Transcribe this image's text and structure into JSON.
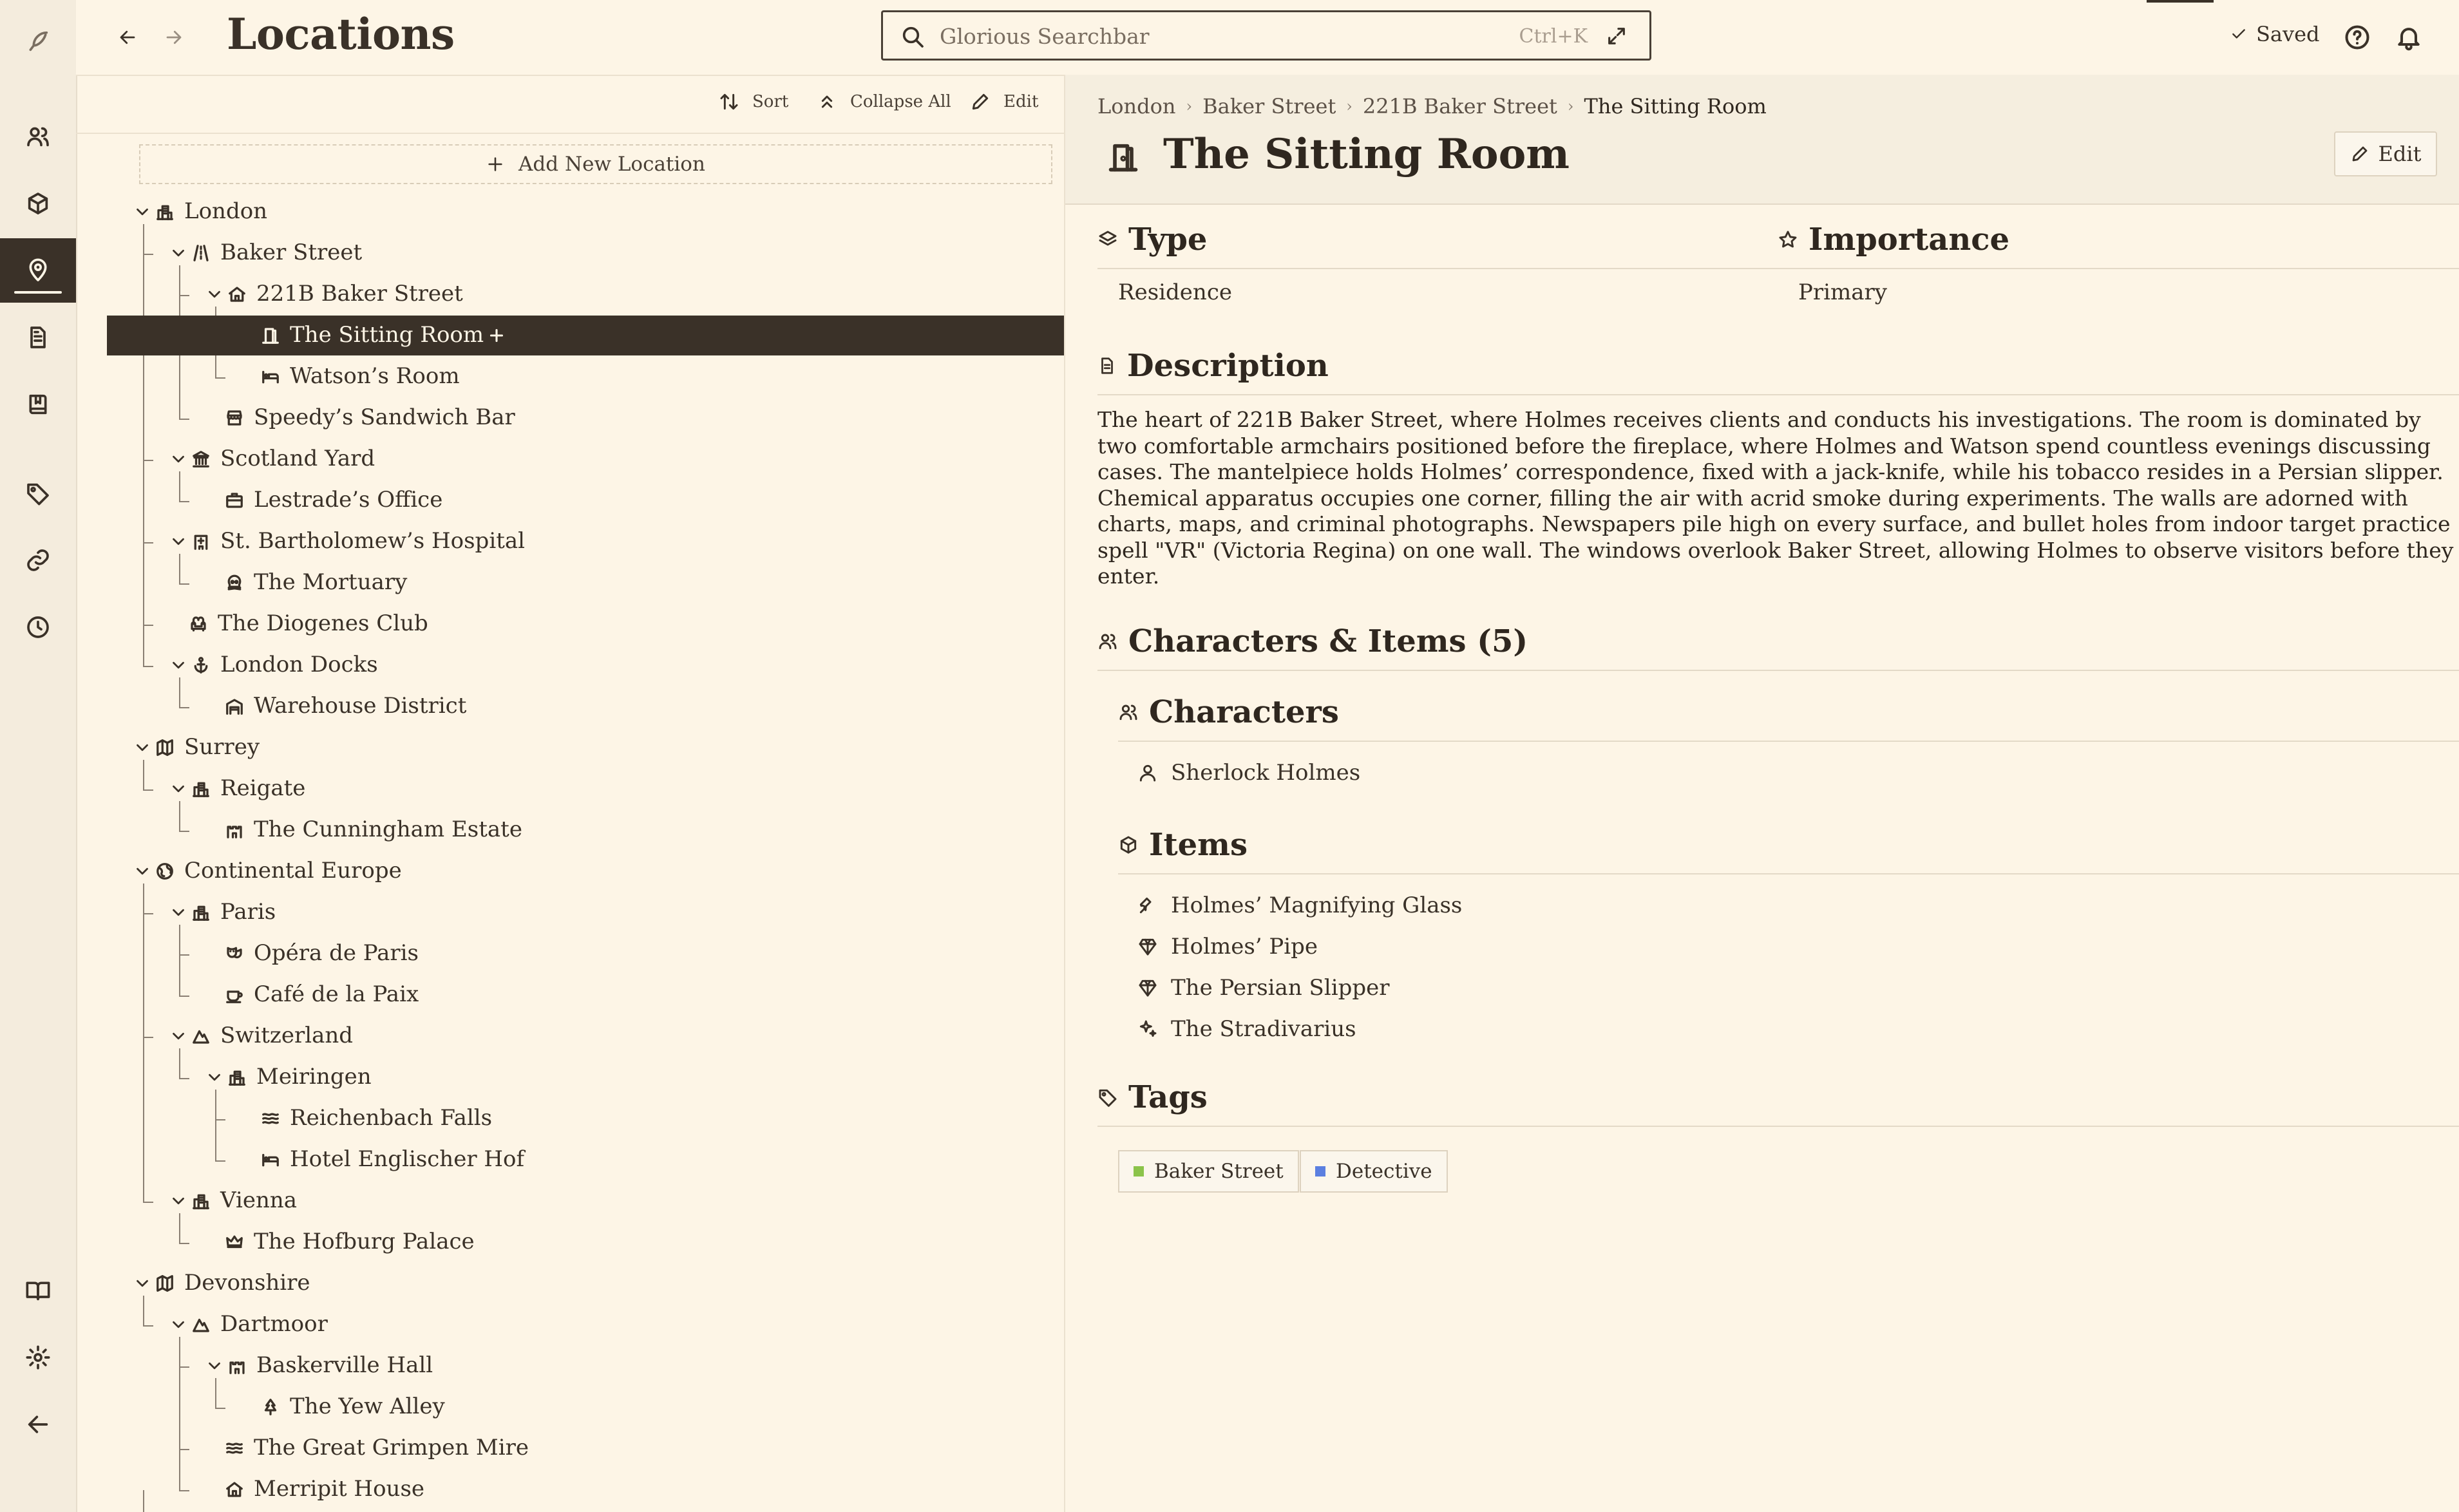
{
  "header": {
    "title": "Locations",
    "search_placeholder": "Glorious Searchbar",
    "search_shortcut": "Ctrl+K",
    "saved_label": "Saved"
  },
  "tree_toolbar": {
    "sort_label": "Sort",
    "collapse_label": "Collapse All",
    "edit_label": "Edit",
    "add_label": "Add New Location"
  },
  "tree": [
    {
      "label": "London",
      "icon": "city-icon"
    },
    {
      "label": "Baker Street",
      "icon": "road-icon"
    },
    {
      "label": "221B Baker Street",
      "icon": "house-icon"
    },
    {
      "label": "The Sitting Room",
      "icon": "door-icon"
    },
    {
      "label": "Watson’s Room",
      "icon": "bed-icon"
    },
    {
      "label": "Speedy’s Sandwich Bar",
      "icon": "store-icon"
    },
    {
      "label": "Scotland Yard",
      "icon": "landmark-icon"
    },
    {
      "label": "Lestrade’s Office",
      "icon": "briefcase-icon"
    },
    {
      "label": "St. Bartholomew’s Hospital",
      "icon": "hospital-icon"
    },
    {
      "label": "The Mortuary",
      "icon": "skull-icon"
    },
    {
      "label": "The Diogenes Club",
      "icon": "armchair-icon"
    },
    {
      "label": "London Docks",
      "icon": "anchor-icon"
    },
    {
      "label": "Warehouse District",
      "icon": "warehouse-icon"
    },
    {
      "label": "Surrey",
      "icon": "map-icon"
    },
    {
      "label": "Reigate",
      "icon": "city-icon"
    },
    {
      "label": "The Cunningham Estate",
      "icon": "castle-icon"
    },
    {
      "label": "Continental Europe",
      "icon": "globe-icon"
    },
    {
      "label": "Paris",
      "icon": "city-icon"
    },
    {
      "label": "Opéra de Paris",
      "icon": "theater-icon"
    },
    {
      "label": "Café de la Paix",
      "icon": "coffee-icon"
    },
    {
      "label": "Switzerland",
      "icon": "mountain-icon"
    },
    {
      "label": "Meiringen",
      "icon": "city-icon"
    },
    {
      "label": "Reichenbach Falls",
      "icon": "waves-icon"
    },
    {
      "label": "Hotel Englischer Hof",
      "icon": "bed-icon"
    },
    {
      "label": "Vienna",
      "icon": "city-icon"
    },
    {
      "label": "The Hofburg Palace",
      "icon": "crown-icon"
    },
    {
      "label": "Devonshire",
      "icon": "map-icon"
    },
    {
      "label": "Dartmoor",
      "icon": "mountain-icon"
    },
    {
      "label": "Baskerville Hall",
      "icon": "castle-icon"
    },
    {
      "label": "The Yew Alley",
      "icon": "tree-icon"
    },
    {
      "label": "The Great Grimpen Mire",
      "icon": "waves-icon"
    },
    {
      "label": "Merripit House",
      "icon": "house-icon"
    }
  ],
  "detail": {
    "breadcrumb": [
      "London",
      "Baker Street",
      "221B Baker Street"
    ],
    "breadcrumb_current": "The Sitting Room",
    "title": "The Sitting Room",
    "edit_label": "Edit",
    "type_label": "Type",
    "type_value": "Residence",
    "importance_label": "Importance",
    "importance_value": "Primary",
    "description_label": "Description",
    "description": "The heart of 221B Baker Street, where Holmes receives clients and conducts his investigations. The room is dominated by two comfortable armchairs positioned before the fireplace, where Holmes and Watson spend countless evenings discussing cases. The mantelpiece holds Holmes’ correspondence, fixed with a jack-knife, while his tobacco resides in a Persian slipper. Chemical apparatus occupies one corner, filling the air with acrid smoke during experiments. The walls are adorned with charts, maps, and criminal photographs. Newspapers pile high on every surface, and bullet holes from indoor target practice spell \"VR\" (Victoria Regina) on one wall. The windows overlook Baker Street, allowing Holmes to observe visitors before they enter.",
    "chars_items_label": "Characters & Items (5)",
    "characters_label": "Characters",
    "characters": [
      {
        "label": "Sherlock Holmes",
        "icon": "user-icon"
      }
    ],
    "items_label": "Items",
    "items": [
      {
        "label": "Holmes’ Magnifying Glass",
        "icon": "wrench-icon"
      },
      {
        "label": "Holmes’ Pipe",
        "icon": "gem-icon"
      },
      {
        "label": "The Persian Slipper",
        "icon": "gem-icon"
      },
      {
        "label": "The Stradivarius",
        "icon": "sparkles-icon"
      }
    ],
    "tags_label": "Tags",
    "tags": [
      {
        "label": "Baker Street",
        "color": "#8bc34a"
      },
      {
        "label": "Detective",
        "color": "#5b7fe0"
      }
    ]
  },
  "colors": {
    "background": "#fdf5e6",
    "rail": "#f4ecdd",
    "ink": "#3a3128",
    "selected": "#3a3128",
    "header_panel": "#f5eedf"
  }
}
